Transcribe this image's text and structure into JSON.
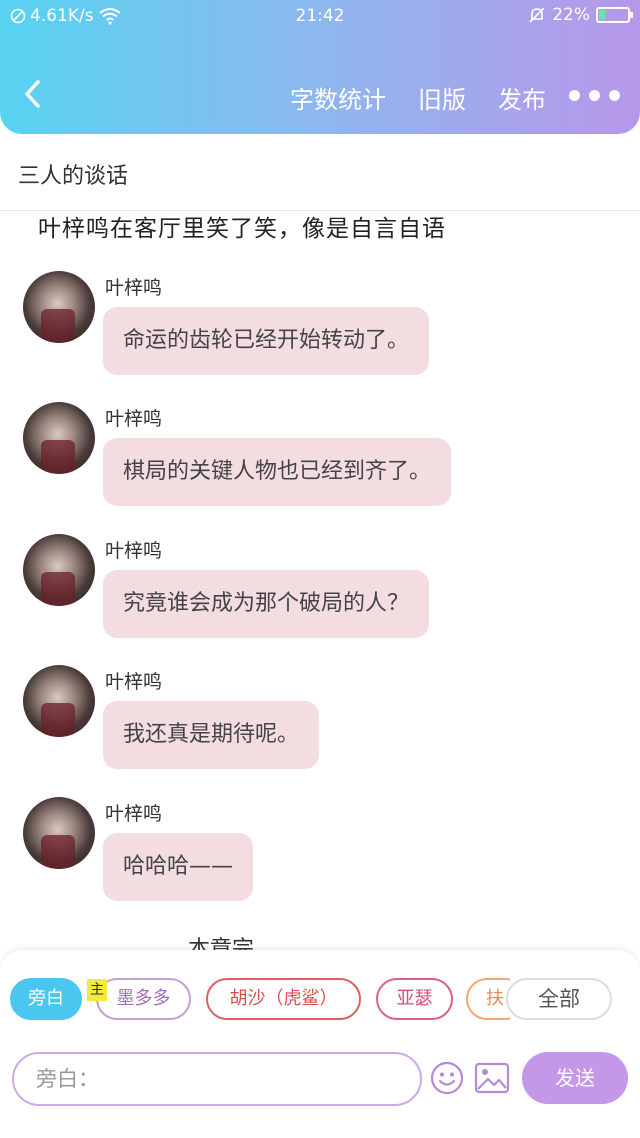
{
  "status_bar": {
    "network_speed": "4.61K/s",
    "time": "21:42",
    "battery": "22%",
    "battery_level": 0.22
  },
  "header": {
    "back_icon": "chevron-left-icon",
    "actions": [
      "字数统计",
      "旧版",
      "发布"
    ],
    "more_icon": "more-dots-icon"
  },
  "chapter": {
    "title": "三人的谈话"
  },
  "chat": {
    "narration_top": "叶梓鸣在客厅里笑了笑，像是自言自语",
    "messages": [
      {
        "speaker": "叶梓鸣",
        "text": "命运的齿轮已经开始转动了。"
      },
      {
        "speaker": "叶梓鸣",
        "text": "棋局的关键人物也已经到齐了。"
      },
      {
        "speaker": "叶梓鸣",
        "text": "究竟谁会成为那个破局的人？"
      },
      {
        "speaker": "叶梓鸣",
        "text": "我还真是期待呢。"
      },
      {
        "speaker": "叶梓鸣",
        "text": "哈哈哈——"
      }
    ],
    "narration_bottom": "本章完"
  },
  "role_bar": {
    "narration_chip": "旁白",
    "main_tag": "主",
    "roles": [
      "墨多多",
      "胡沙（虎鲨）",
      "亚瑟",
      "扶"
    ],
    "all_label": "全部"
  },
  "composer": {
    "placeholder": "旁白：",
    "send_label": "发送",
    "emoji_icon": "emoji-smile-icon",
    "image_icon": "image-icon"
  },
  "colors": {
    "header_gradient_start": "#56d3f0",
    "header_gradient_end": "#b797ea",
    "bubble": "#f3dde0",
    "send_button": "#c497e8"
  }
}
